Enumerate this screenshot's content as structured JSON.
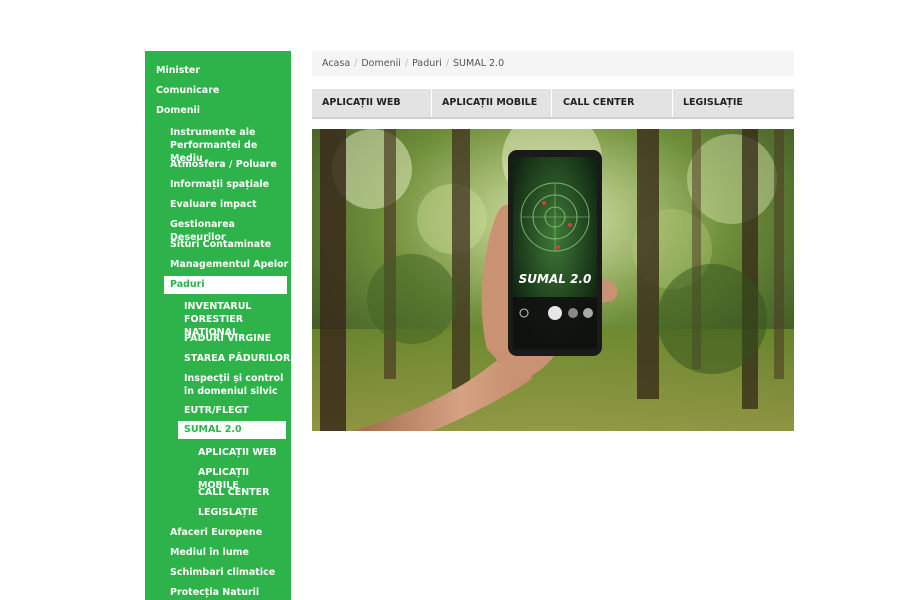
{
  "sidebar": {
    "items": [
      {
        "label": "Minister"
      },
      {
        "label": "Comunicare"
      },
      {
        "label": "Domenii"
      },
      {
        "label": "Instrumente ale Performanței de Mediu"
      },
      {
        "label": "Atmosfera / Poluare"
      },
      {
        "label": "Informații spațiale"
      },
      {
        "label": "Evaluare impact"
      },
      {
        "label": "Gestionarea Deșeurilor"
      },
      {
        "label": "Situri Contaminate"
      },
      {
        "label": "Managementul Apelor"
      },
      {
        "label": "Paduri"
      },
      {
        "label": "INVENTARUL FORESTIER NAȚIONAL"
      },
      {
        "label": "PADURI VIRGINE"
      },
      {
        "label": "STAREA PĂDURILOR"
      },
      {
        "label": "Inspecții și control în domeniul silvic"
      },
      {
        "label": "EUTR/FLEGT"
      },
      {
        "label": "SUMAL 2.0"
      },
      {
        "label": "APLICAȚII WEB"
      },
      {
        "label": "APLICAȚII MOBILE"
      },
      {
        "label": "CALL CENTER"
      },
      {
        "label": "LEGISLAȚIE"
      },
      {
        "label": "Afaceri Europene"
      },
      {
        "label": "Mediul în lume"
      },
      {
        "label": "Schimbari climatice"
      },
      {
        "label": "Protecția Naturii"
      }
    ]
  },
  "breadcrumb": {
    "items": [
      "Acasa",
      "Domenii",
      "Paduri",
      "SUMAL 2.0"
    ],
    "separator": "/"
  },
  "tabs": [
    "APLICAȚII WEB",
    "APLICAȚII MOBILE",
    "CALL CENTER",
    "LEGISLAȚIE"
  ],
  "hero": {
    "phone_text": "SUMAL 2.0"
  },
  "colors": {
    "sidebar_bg": "#2db34a",
    "active_bg": "#ffffff"
  }
}
